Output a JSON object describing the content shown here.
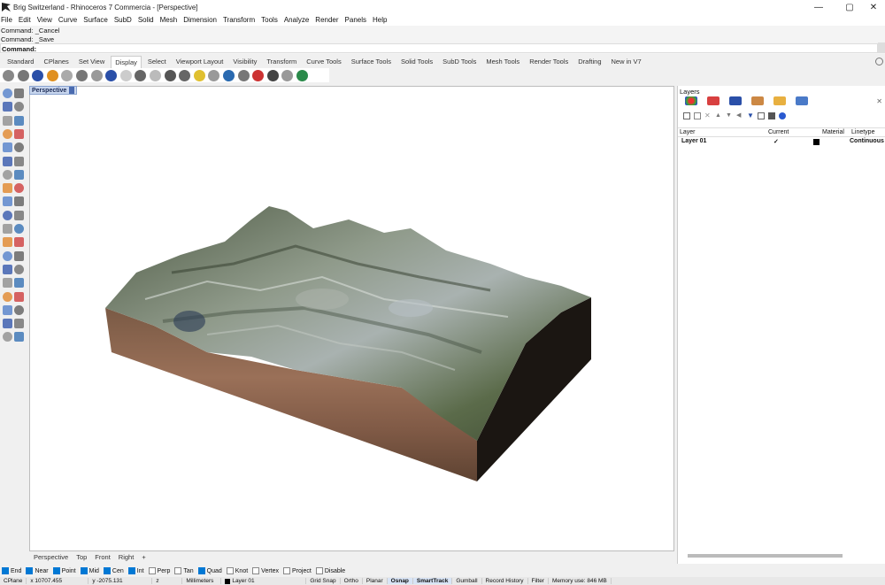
{
  "window": {
    "title": "Brig Switzerland - Rhinoceros 7 Commercia - [Perspective]"
  },
  "menu": [
    "File",
    "Edit",
    "View",
    "Curve",
    "Surface",
    "SubD",
    "Solid",
    "Mesh",
    "Dimension",
    "Transform",
    "Tools",
    "Analyze",
    "Render",
    "Panels",
    "Help"
  ],
  "command": {
    "history": [
      "Command: _Cancel",
      "Command: _Save"
    ],
    "prompt": "Command:"
  },
  "toolbar_tabs": [
    "Standard",
    "CPlanes",
    "Set View",
    "Display",
    "Select",
    "Viewport Layout",
    "Visibility",
    "Transform",
    "Curve Tools",
    "Surface Tools",
    "Solid Tools",
    "SubD Tools",
    "Mesh Tools",
    "Render Tools",
    "Drafting",
    "New in V7"
  ],
  "active_toolbar_tab": "Display",
  "toolbar_icons": [
    "wireframe-icon",
    "shaded-icon",
    "rendered-icon",
    "ghosted-icon",
    "xray-icon",
    "technical-icon",
    "artistic-icon",
    "pen-icon",
    "arctic-icon",
    "raytraced-icon",
    "monochrome-icon",
    "sphere-icon",
    "material-icon",
    "light-icon",
    "camera-icon",
    "clipping-icon",
    "section-icon",
    "display-settings-icon",
    "capture-icon",
    "render-preview-icon",
    "layout-icon"
  ],
  "viewport": {
    "active_label": "Perspective",
    "tabs": [
      "Perspective",
      "Top",
      "Front",
      "Right"
    ]
  },
  "layers_panel": {
    "title": "Layers",
    "columns": {
      "layer": "Layer",
      "current": "Current",
      "material": "Material",
      "linetype": "Linetype"
    },
    "rows": [
      {
        "name": "Layer 01",
        "current": "✓",
        "linetype": "Continuous"
      }
    ]
  },
  "osnaps": [
    {
      "label": "End",
      "checked": true
    },
    {
      "label": "Near",
      "checked": true
    },
    {
      "label": "Point",
      "checked": true
    },
    {
      "label": "Mid",
      "checked": true
    },
    {
      "label": "Cen",
      "checked": true
    },
    {
      "label": "Int",
      "checked": true
    },
    {
      "label": "Perp",
      "checked": false
    },
    {
      "label": "Tan",
      "checked": false
    },
    {
      "label": "Quad",
      "checked": true
    },
    {
      "label": "Knot",
      "checked": false
    },
    {
      "label": "Vertex",
      "checked": false
    },
    {
      "label": "Project",
      "checked": false
    },
    {
      "label": "Disable",
      "checked": false
    }
  ],
  "status": {
    "cplane": "CPlane",
    "x": "x 10707.455",
    "y": "y -2075.131",
    "z": "z",
    "units": "Millimeters",
    "layer": "Layer 01",
    "toggles": [
      {
        "label": "Grid Snap",
        "on": false
      },
      {
        "label": "Ortho",
        "on": false
      },
      {
        "label": "Planar",
        "on": false
      },
      {
        "label": "Osnap",
        "on": true
      },
      {
        "label": "SmartTrack",
        "on": true
      },
      {
        "label": "Gumball",
        "on": false
      },
      {
        "label": "Record History",
        "on": false
      },
      {
        "label": "Filter",
        "on": false
      }
    ],
    "memory": "Memory use: 846 MB"
  }
}
